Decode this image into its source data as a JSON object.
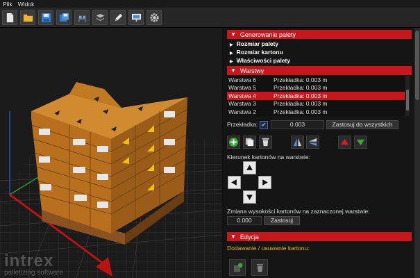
{
  "menu": {
    "file": "Plik",
    "view": "Widok"
  },
  "toolbar": {
    "icons": [
      "new-file-icon",
      "open-folder-icon",
      "save-icon",
      "save-as-icon",
      "pallet-view-icon",
      "layer-view-icon",
      "edit-pencil-icon",
      "presentation-icon",
      "settings-gear-icon"
    ]
  },
  "viewport": {
    "brand": "intrex",
    "tagline": "palletizing software"
  },
  "sections": {
    "generation": "Generowanie palety",
    "layers": "Warstwy",
    "edit": "Edycja"
  },
  "generation_items": [
    "Rozmiar palety",
    "Rozmiar kartonu",
    "Właściwości palety"
  ],
  "layers": [
    {
      "name": "Warstwa 6",
      "spacer": "Przekładka: 0.003 m",
      "selected": false
    },
    {
      "name": "Warstwa 5",
      "spacer": "Przekładka: 0.003 m",
      "selected": false
    },
    {
      "name": "Warstwa 4",
      "spacer": "Przekładka: 0.003 m",
      "selected": true
    },
    {
      "name": "Warstwa 3",
      "spacer": "Przekładka: 0.003 m",
      "selected": false
    },
    {
      "name": "Warstwa 2",
      "spacer": "Przekładka: 0.003 m",
      "selected": false
    }
  ],
  "spacer": {
    "label": "Przekładka:",
    "checked": true,
    "value": "0.003",
    "apply_all": "Zastosuj do wszystkich"
  },
  "direction_label": "Kierunek kartonów na warstwie:",
  "height_change": {
    "label": "Zmiana wysokości kartonów na zaznaczonej warstwie:",
    "value": "0.000",
    "apply": "Zastosuj"
  },
  "edit": {
    "add_remove_label": "Dodawanie / usuwanie kartonu:"
  },
  "colors": {
    "accent": "#c8161d",
    "box": "#c07a22",
    "highlight": "#e8b800"
  }
}
